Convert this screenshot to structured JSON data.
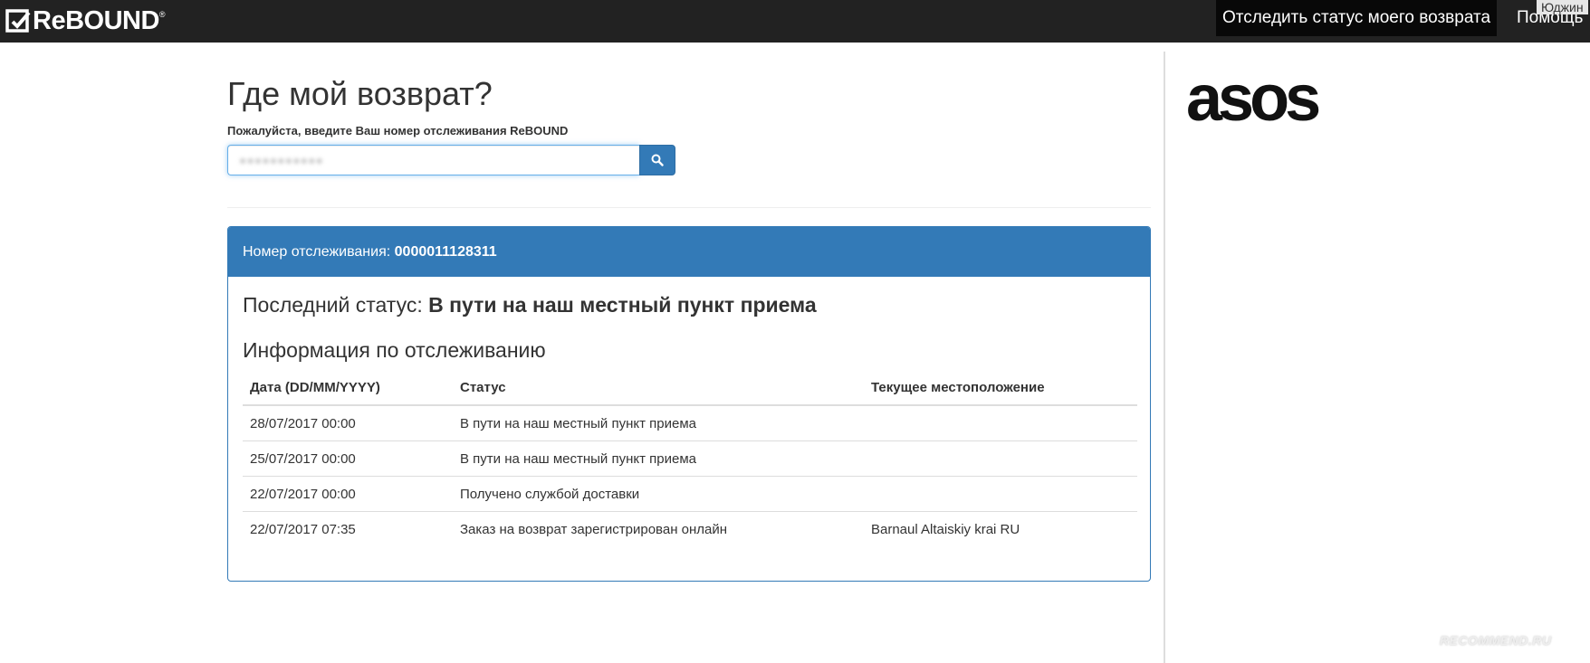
{
  "navbar": {
    "brand": "ReBOUND",
    "brand_reg": "®",
    "track_link": "Отследить статус моего возврата",
    "help_link": "Помощь",
    "user_name": "Юджин"
  },
  "main": {
    "title": "Где мой возврат?",
    "form_label": "Пожалуйста, введите Ваш номер отслеживания ReBOUND",
    "search_placeholder": "●●●●●●●●●●●",
    "tracking_label": "Номер отслеживания: ",
    "tracking_number": "0000011128311",
    "last_status_label": "Последний статус: ",
    "last_status_value": "В пути на наш местный пункт приема",
    "info_title": "Информация по отслеживанию",
    "table": {
      "headers": [
        "Дата (DD/MM/YYYY)",
        "Статус",
        "Текущее местоположение"
      ],
      "rows": [
        [
          "28/07/2017 00:00",
          "В пути на наш местный пункт приема",
          ""
        ],
        [
          "25/07/2017 00:00",
          "В пути на наш местный пункт приема",
          ""
        ],
        [
          "22/07/2017 00:00",
          "Получено службой доставки",
          ""
        ],
        [
          "22/07/2017 07:35",
          "Заказ на возврат зарегистрирован онлайн",
          "Barnaul Altaiskiy krai RU"
        ]
      ]
    }
  },
  "sidebar": {
    "partner_logo": "asos"
  },
  "watermark": "RECOMMEND.RU",
  "icons": {
    "search": "search-icon",
    "brand": "rebound-logo-icon"
  },
  "colors": {
    "navbar": "#222222",
    "primary": "#337ab7"
  }
}
